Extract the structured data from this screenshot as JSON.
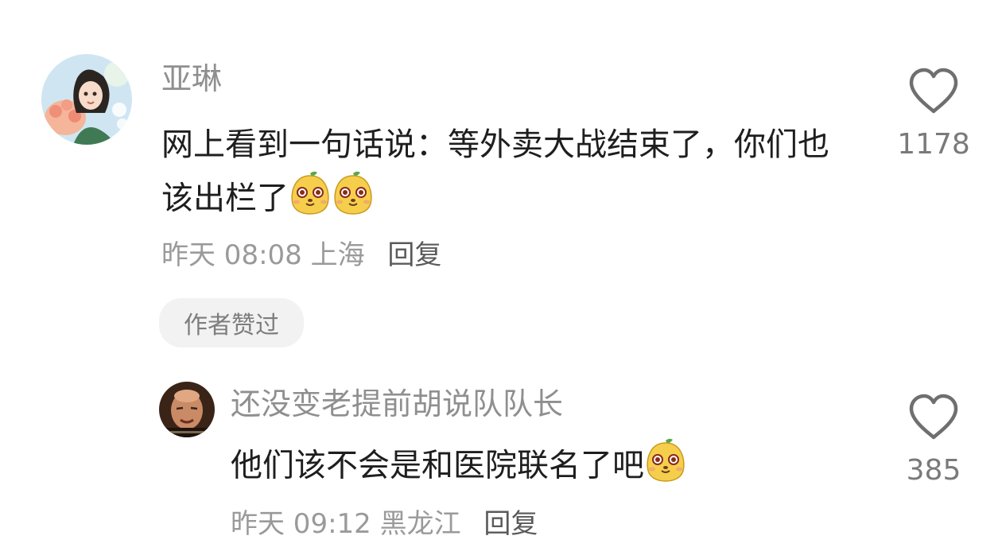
{
  "comments": [
    {
      "username": "亚琳",
      "text": "网上看到一句话说：等外卖大战结束了，你们也该出栏了",
      "emoji_count": 2,
      "emoji_icon": "mango-mascot-emoji",
      "time": "昨天 08:08",
      "location": "上海",
      "reply_label": "回复",
      "badge": "作者赞过",
      "like_count": "1178",
      "like_icon": "heart-outline-icon"
    },
    {
      "username": "还没变老提前胡说队队长",
      "text": "他们该不会是和医院联名了吧",
      "emoji_count": 1,
      "emoji_icon": "mango-mascot-emoji",
      "time": "昨天 09:12",
      "location": "黑龙江",
      "reply_label": "回复",
      "like_count": "385",
      "like_icon": "heart-outline-icon"
    }
  ]
}
